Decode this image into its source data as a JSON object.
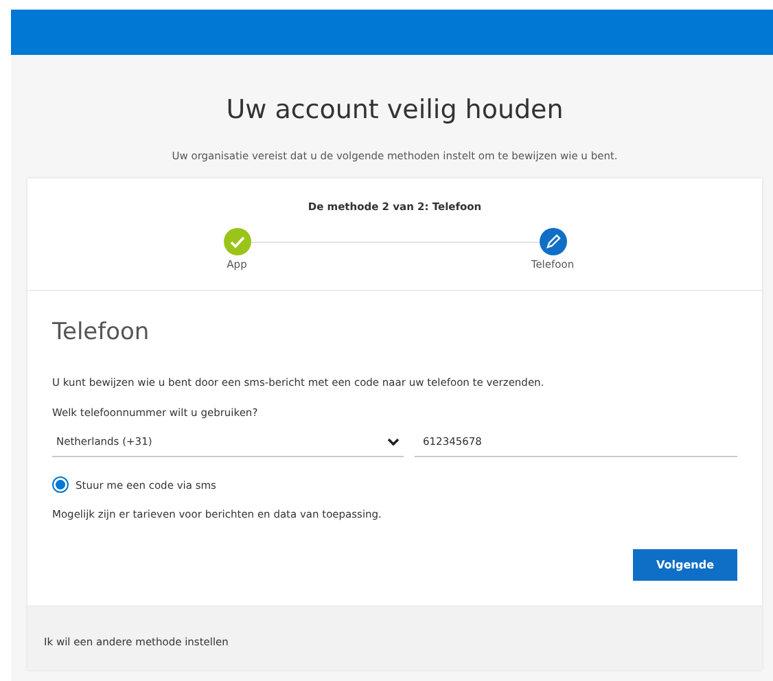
{
  "title": "Uw account veilig houden",
  "subtitle": "Uw organisatie vereist dat u de volgende methoden instelt om te bewijzen wie u bent.",
  "progress": {
    "label": "De methode 2 van 2: Telefoon",
    "steps": [
      {
        "label": "App",
        "kind": "done"
      },
      {
        "label": "Telefoon",
        "kind": "current"
      }
    ]
  },
  "section": {
    "heading": "Telefoon",
    "intro": "U kunt bewijzen wie u bent door een sms-bericht met een code naar uw telefoon te verzenden.",
    "question": "Welk telefoonnummer wilt u gebruiken?",
    "country": {
      "value": "Netherlands (+31)"
    },
    "phone": {
      "value": "612345678"
    },
    "options": [
      {
        "label": "Stuur me een code via sms",
        "selected": true
      }
    ],
    "note": "Mogelijk zijn er tarieven voor berichten en data van toepassing.",
    "button": "Volgende"
  },
  "footer_link": "Ik wil een andere methode instellen"
}
